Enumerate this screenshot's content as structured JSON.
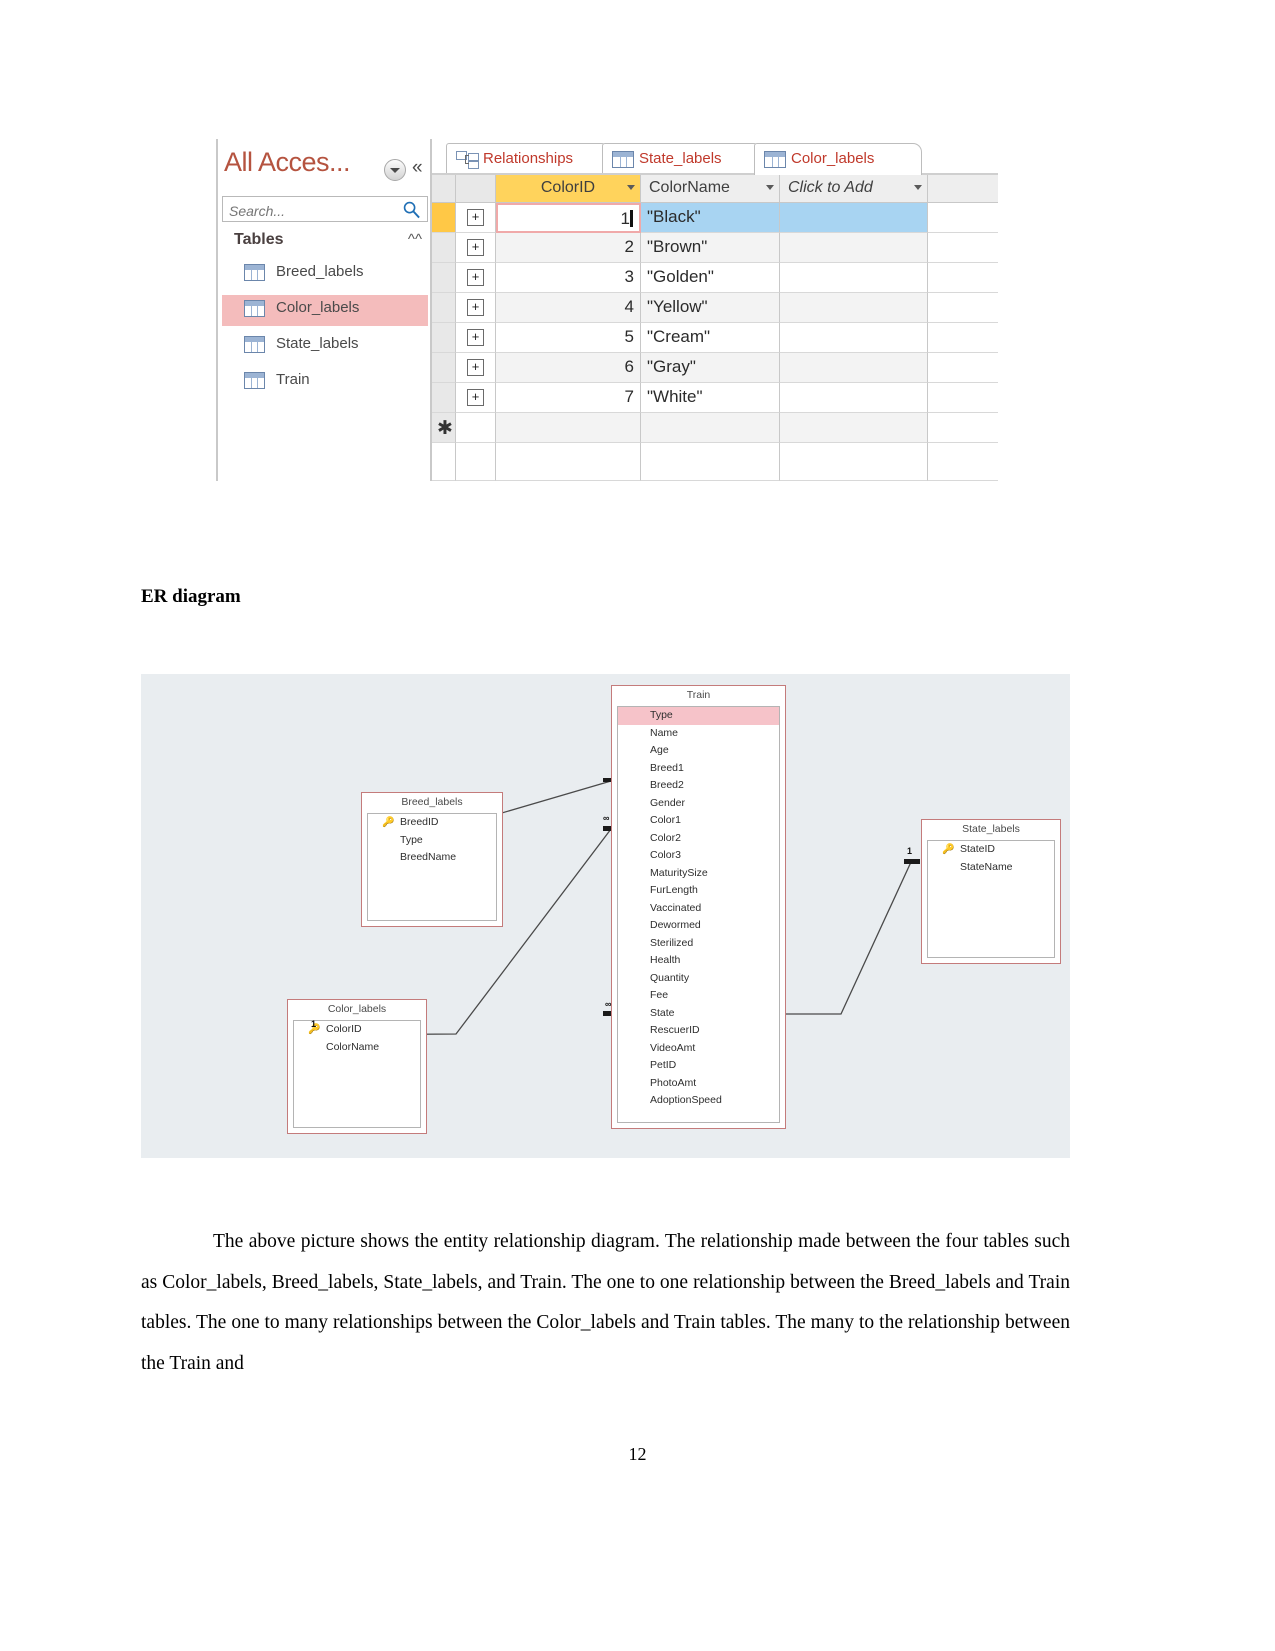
{
  "document": {
    "er_heading": "ER diagram",
    "paragraph": "The above picture shows the entity relationship diagram. The relationship made between the four tables such as Color_labels, Breed_labels, State_labels, and Train. The one to one relationship between the Breed_labels and Train tables. The one to many relationships between the Color_labels and Train tables. The many to the relationship between the Train and",
    "page_number": "12"
  },
  "access": {
    "nav_pane": {
      "title": "All Acces...",
      "dropdown_icon": "chevron-down-circle-icon",
      "collapse_icon": "double-chevron-left-icon",
      "search": {
        "placeholder": "Search...",
        "value": "",
        "icon": "search-icon"
      },
      "group_header": "Tables",
      "group_collapse_icon": "double-chevron-up-icon",
      "items": [
        {
          "label": "Breed_labels",
          "selected": false
        },
        {
          "label": "Color_labels",
          "selected": true
        },
        {
          "label": "State_labels",
          "selected": false
        },
        {
          "label": "Train",
          "selected": false
        }
      ]
    },
    "tabs": [
      {
        "label": "Relationships",
        "icon": "relationships-icon",
        "active": false
      },
      {
        "label": "State_labels",
        "icon": "table-icon",
        "active": false
      },
      {
        "label": "Color_labels",
        "icon": "table-icon",
        "active": true
      }
    ],
    "datasheet": {
      "columns": [
        "ColorID",
        "ColorName",
        "Click to Add"
      ],
      "rows": [
        {
          "id": "1",
          "name": "\"Black\"",
          "current": true
        },
        {
          "id": "2",
          "name": "\"Brown\"",
          "current": false
        },
        {
          "id": "3",
          "name": "\"Golden\"",
          "current": false
        },
        {
          "id": "4",
          "name": "\"Yellow\"",
          "current": false
        },
        {
          "id": "5",
          "name": "\"Cream\"",
          "current": false
        },
        {
          "id": "6",
          "name": "\"Gray\"",
          "current": false
        },
        {
          "id": "7",
          "name": "\"White\"",
          "current": false
        }
      ],
      "new_row_marker": "✱",
      "expand_glyph": "+",
      "header_accent": "#ffd35c",
      "selection_color": "#a8d4f2"
    }
  },
  "er_diagram": {
    "entities": {
      "train": {
        "title": "Train",
        "fields": [
          "Type",
          "Name",
          "Age",
          "Breed1",
          "Breed2",
          "Gender",
          "Color1",
          "Color2",
          "Color3",
          "MaturitySize",
          "FurLength",
          "Vaccinated",
          "Dewormed",
          "Sterilized",
          "Health",
          "Quantity",
          "Fee",
          "State",
          "RescuerID",
          "VideoAmt",
          "PetID",
          "PhotoAmt",
          "AdoptionSpeed"
        ],
        "highlighted_field": "Type"
      },
      "breed_labels": {
        "title": "Breed_labels",
        "fields": [
          "BreedID",
          "Type",
          "BreedName"
        ],
        "primary_key": "BreedID"
      },
      "color_labels": {
        "title": "Color_labels",
        "fields": [
          "ColorID",
          "ColorName"
        ],
        "primary_key": "ColorID"
      },
      "state_labels": {
        "title": "State_labels",
        "fields": [
          "StateID",
          "StateName"
        ],
        "primary_key": "StateID"
      }
    },
    "relationships": [
      {
        "from": "Breed_labels",
        "to": "Train",
        "from_card": "1",
        "to_card": "1"
      },
      {
        "from": "Color_labels",
        "to": "Train",
        "from_card": "1",
        "to_card": "∞"
      },
      {
        "from": "Train",
        "to": "State_labels",
        "from_card": "∞",
        "to_card": "1"
      }
    ],
    "colors": {
      "canvas": "#e9edf0",
      "entity_border": "#c47b7b",
      "highlight": "#f6c3c9"
    }
  }
}
